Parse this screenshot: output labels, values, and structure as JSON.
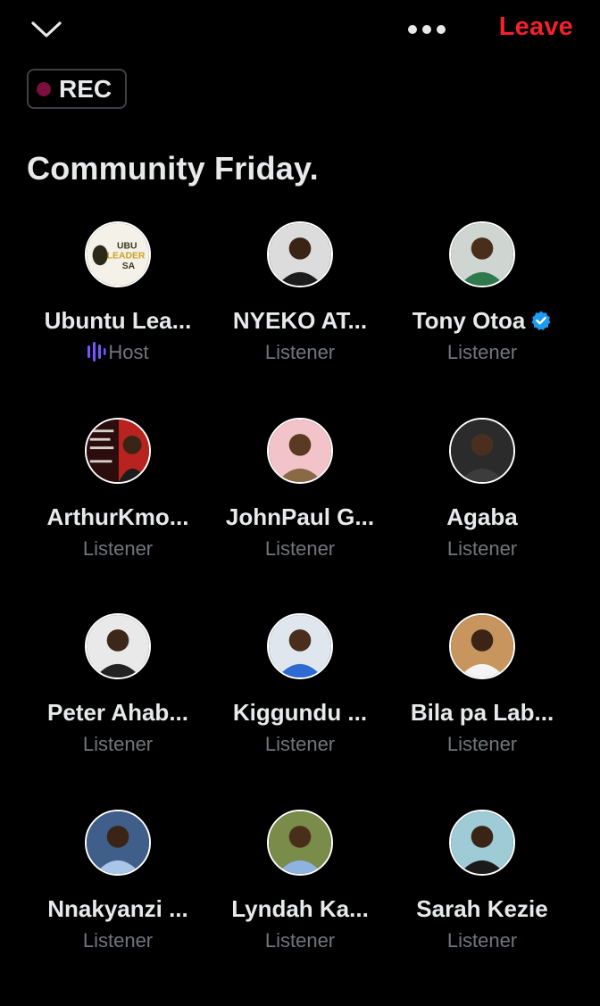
{
  "header": {
    "leave_label": "Leave",
    "rec_label": "REC",
    "title": "Community Friday."
  },
  "colors": {
    "background": "#000000",
    "leave": "#f4212e",
    "rec_dot": "#7b0f3d",
    "muted": "#71767b",
    "verified": "#1d9bf0",
    "host_accent": "#7856ff"
  },
  "participants": [
    {
      "name": "Ubuntu Lea...",
      "role": "Host",
      "avatar_icon": "logo-avatar",
      "avatar_text": "UBU LEADER SA"
    },
    {
      "name": "NYEKO AT...",
      "role": "Listener",
      "avatar_icon": "person-avatar"
    },
    {
      "name": "Tony Otoa",
      "role": "Listener",
      "avatar_icon": "person-avatar",
      "verified": true
    },
    {
      "name": "ArthurKmo...",
      "role": "Listener",
      "avatar_icon": "poster-avatar"
    },
    {
      "name": "JohnPaul G...",
      "role": "Listener",
      "avatar_icon": "person-avatar"
    },
    {
      "name": "Agaba",
      "role": "Listener",
      "avatar_icon": "person-avatar"
    },
    {
      "name": "Peter Ahab...",
      "role": "Listener",
      "avatar_icon": "person-avatar"
    },
    {
      "name": "Kiggundu ...",
      "role": "Listener",
      "avatar_icon": "person-avatar"
    },
    {
      "name": "Bila pa Lab...",
      "role": "Listener",
      "avatar_icon": "person-avatar"
    },
    {
      "name": "Nnakyanzi ...",
      "role": "Listener",
      "avatar_icon": "person-avatar"
    },
    {
      "name": "Lyndah Ka...",
      "role": "Listener",
      "avatar_icon": "person-avatar"
    },
    {
      "name": "Sarah Kezie",
      "role": "Listener",
      "avatar_icon": "person-avatar"
    }
  ]
}
